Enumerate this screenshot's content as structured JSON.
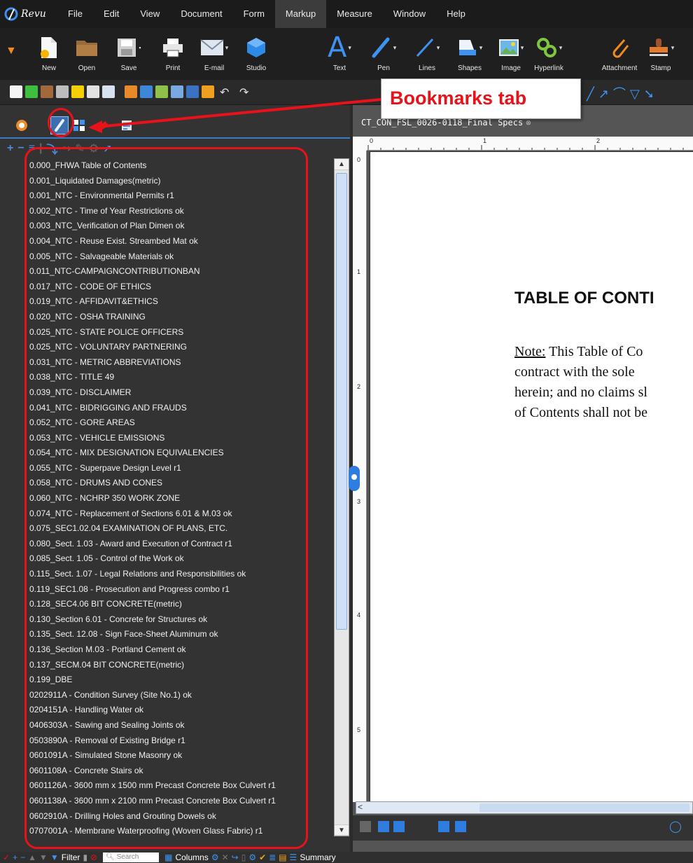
{
  "app": {
    "name": "Revu"
  },
  "menu": [
    "File",
    "Edit",
    "View",
    "Document",
    "Form",
    "Markup",
    "Measure",
    "Window",
    "Help"
  ],
  "menu_active": "Markup",
  "toolbar": {
    "tools": [
      "New",
      "Open",
      "Save",
      "Print",
      "E-mail",
      "Studio",
      "Text",
      "Pen",
      "Lines",
      "Shapes",
      "Image",
      "Hyperlink",
      "Attachment",
      "Stamp"
    ]
  },
  "callout": {
    "text": "Bookmarks tab"
  },
  "document": {
    "tab_title": "CT_CON_FSL_0026-0118_Final Specs",
    "heading": "TABLE OF CONTI",
    "para_lines": [
      "This Table of Co",
      "contract with the sole",
      "herein; and no claims sl",
      "of Contents shall not be"
    ],
    "para_note_label": "Note:",
    "ruler_h": [
      "0",
      "1",
      "2"
    ],
    "ruler_v": [
      "0",
      "1",
      "2",
      "3",
      "4",
      "5"
    ]
  },
  "bookmarks": [
    "0.000_FHWA Table of Contents",
    "0.001_Liquidated Damages(metric)",
    "0.001_NTC - Environmental Permits r1",
    "0.002_NTC - Time of Year Restrictions ok",
    "0.003_NTC_Verification of Plan Dimen ok",
    "0.004_NTC - Reuse Exist. Streambed Mat ok",
    "0.005_NTC - Salvageable Materials ok",
    "0.011_NTC-CAMPAIGNCONTRIBUTIONBAN",
    "0.017_NTC - CODE OF ETHICS",
    "0.019_NTC - AFFIDAVIT&ETHICS",
    "0.020_NTC - OSHA TRAINING",
    "0.025_NTC - STATE POLICE OFFICERS",
    "0.025_NTC - VOLUNTARY PARTNERING",
    "0.031_NTC - METRIC ABBREVIATIONS",
    "0.038_NTC - TITLE 49",
    "0.039_NTC - DISCLAIMER",
    "0.041_NTC - BIDRIGGING AND FRAUDS",
    "0.052_NTC - GORE AREAS",
    "0.053_NTC - VEHICLE EMISSIONS",
    "0.054_NTC - MIX DESIGNATION EQUIVALENCIES",
    "0.055_NTC - Superpave Design Level r1",
    "0.058_NTC - DRUMS AND CONES",
    "0.060_NTC - NCHRP 350 WORK ZONE",
    "0.074_NTC - Replacement of Sections 6.01 & M.03 ok",
    "0.075_SEC1.02.04 EXAMINATION OF PLANS, ETC.",
    "0.080_Sect. 1.03 - Award and Execution of Contract r1",
    "0.085_Sect. 1.05 - Control of the Work ok",
    "0.115_Sect. 1.07 - Legal Relations and Responsibilities ok",
    "0.119_SEC1.08 - Prosecution and Progress combo r1",
    "0.128_SEC4.06 BIT CONCRETE(metric)",
    "0.130_Section 6.01 - Concrete for Structures ok",
    "0.135_Sect. 12.08 - Sign Face-Sheet Aluminum ok",
    "0.136_Section M.03 - Portland Cement ok",
    "0.137_SECM.04 BIT CONCRETE(metric)",
    "0.199_DBE",
    "0202911A - Condition Survey (Site No.1) ok",
    "0204151A - Handling Water ok",
    "0406303A - Sawing and Sealing Joints ok",
    "0503890A - Removal of Existing Bridge r1",
    "0601091A - Simulated Stone Masonry ok",
    "0601108A - Concrete Stairs ok",
    "0601126A - 3600 mm x 1500 mm Precast Concrete Box Culvert r1",
    "0601138A - 3600 mm x 2100 mm Precast Concrete Box Culvert r1",
    "0602910A - Drilling Holes and Grouting Dowels ok",
    "0707001A - Membrane Waterproofing (Woven Glass Fabric) r1"
  ],
  "bottombar": {
    "filter": "Filter",
    "search_placeholder": "Search",
    "columns": "Columns",
    "summary": "Summary"
  },
  "colors": {
    "annotation_red": "#e8121a",
    "accent_blue": "#3f7bc5"
  }
}
